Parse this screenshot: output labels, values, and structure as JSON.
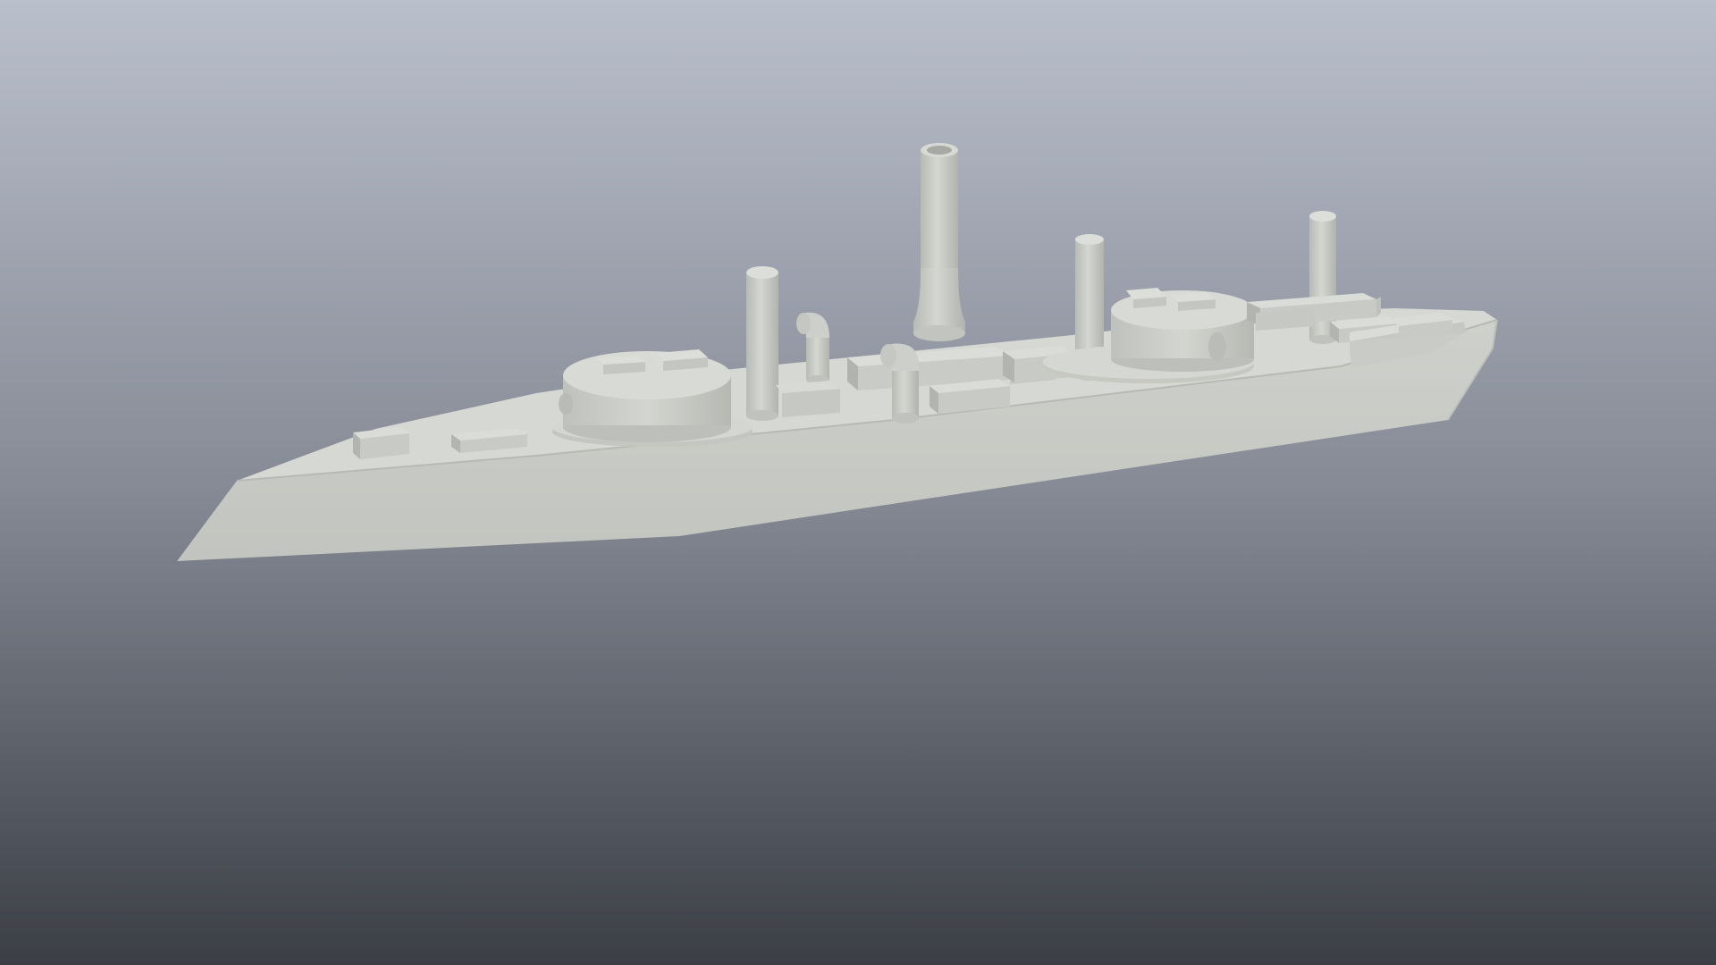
{
  "scene": {
    "subject": "ship-model",
    "background": {
      "top_color": "#b9bfcb",
      "mid_color": "#868b96",
      "bottom_color": "#3b3e45"
    },
    "model_colors": {
      "light": "#d6d8d3",
      "mid": "#c3c5c0",
      "shade": "#aeb0ab",
      "dark": "#9c9e99",
      "edge": "#a8aaa5"
    }
  }
}
